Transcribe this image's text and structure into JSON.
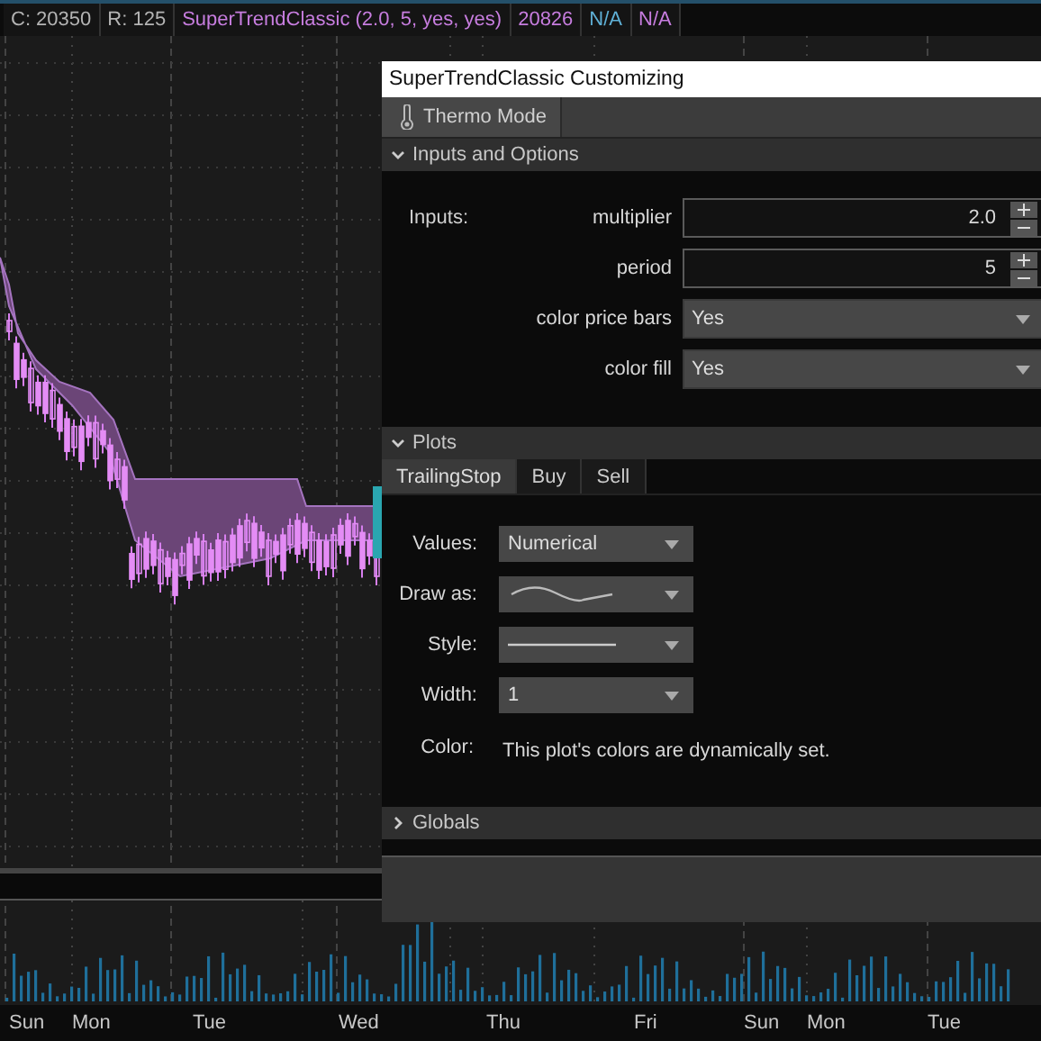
{
  "status_bar": [
    {
      "text": "C: 20350",
      "kind": "readout"
    },
    {
      "text": "R: 125",
      "kind": "readout"
    },
    {
      "text": "SuperTrendClassic (2.0, 5, yes, yes)",
      "kind": "study"
    },
    {
      "text": "20826",
      "kind": "study"
    },
    {
      "text": "N/A",
      "kind": "buy"
    },
    {
      "text": "N/A",
      "kind": "study"
    }
  ],
  "dialog": {
    "title": "SuperTrendClassic Customizing",
    "toolbar": {
      "button": "Thermo Mode"
    },
    "inputs_section": {
      "title": "Inputs and Options",
      "expanded": true,
      "label": "Inputs:",
      "inputs": [
        {
          "name": "multiplier",
          "kind": "spinner",
          "value": "2.0"
        },
        {
          "name": "period",
          "kind": "spinner",
          "value": "5"
        },
        {
          "name": "color price bars",
          "kind": "dropdown",
          "value": "Yes"
        },
        {
          "name": "color fill",
          "kind": "dropdown",
          "value": "Yes"
        }
      ]
    },
    "plots_section": {
      "title": "Plots",
      "expanded": true,
      "tabs": [
        {
          "label": "TrailingStop",
          "selected": true
        },
        {
          "label": "Buy",
          "selected": false
        },
        {
          "label": "Sell",
          "selected": false
        }
      ],
      "settings": [
        {
          "label": "Values:",
          "kind": "text",
          "value": "Numerical"
        },
        {
          "label": "Draw as:",
          "kind": "curve"
        },
        {
          "label": "Style:",
          "kind": "solid-line"
        },
        {
          "label": "Width:",
          "kind": "text",
          "value": "1"
        }
      ],
      "color_label": "Color:",
      "color_note": "This plot's colors are dynamically set."
    },
    "globals_section": {
      "title": "Globals",
      "expanded": false
    }
  },
  "time_axis": [
    "Sun",
    "Mon",
    "Tue",
    "Wed",
    "Thu",
    "Fri",
    "Sun",
    "Mon",
    "Tue"
  ]
}
